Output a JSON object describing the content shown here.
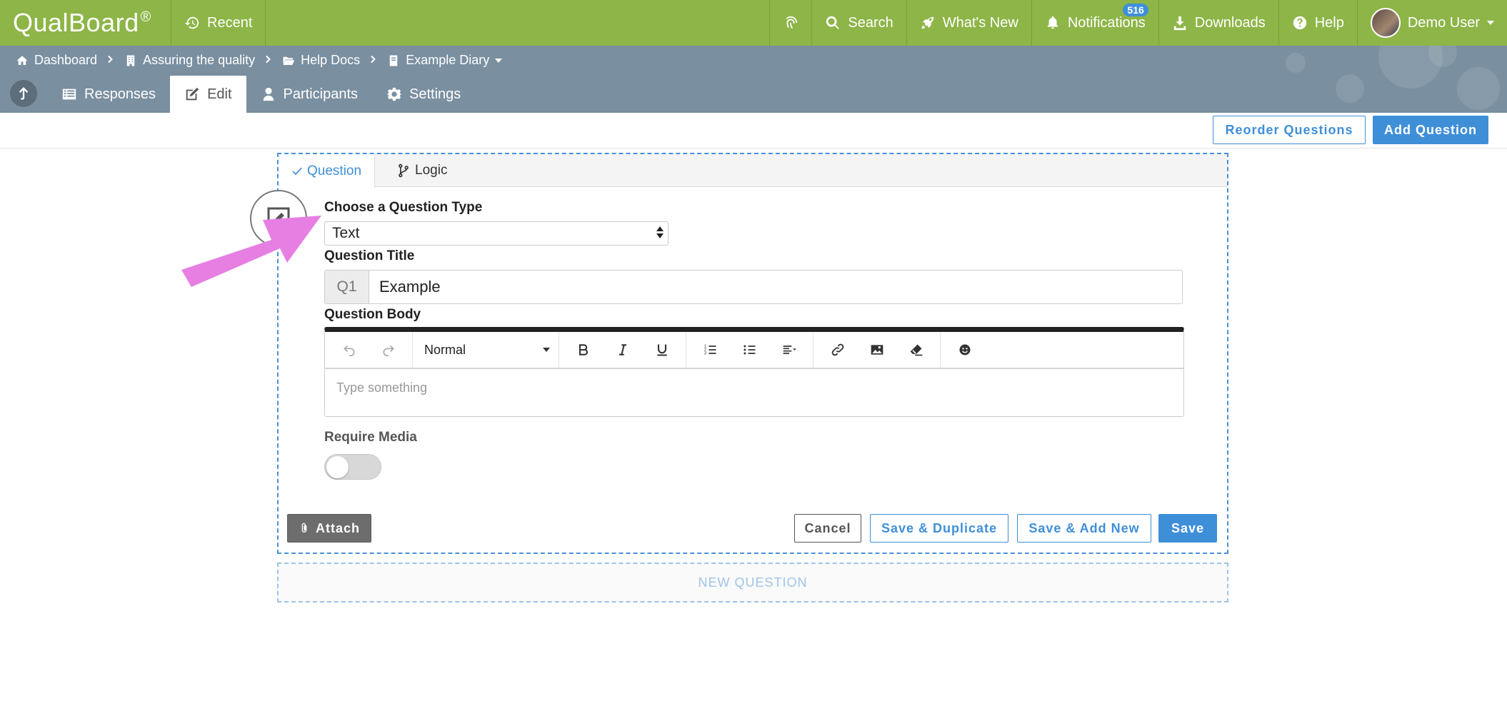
{
  "topbar": {
    "logo": "QualBoard",
    "logo_mark": "®",
    "recent": "Recent",
    "search": "Search",
    "whats_new": "What's New",
    "notifications": "Notifications",
    "notifications_count": "516",
    "downloads": "Downloads",
    "help": "Help",
    "user_name": "Demo User"
  },
  "breadcrumb": [
    {
      "label": "Dashboard",
      "icon": "home-icon"
    },
    {
      "label": "Assuring the quality",
      "icon": "building-icon"
    },
    {
      "label": "Help Docs",
      "icon": "folder-open-icon"
    },
    {
      "label": "Example Diary",
      "icon": "document-icon"
    }
  ],
  "nav_tabs": [
    {
      "label": "Responses",
      "icon": "list-icon",
      "active": false
    },
    {
      "label": "Edit",
      "icon": "edit-icon",
      "active": true
    },
    {
      "label": "Participants",
      "icon": "user-icon",
      "active": false
    },
    {
      "label": "Settings",
      "icon": "gear-icon",
      "active": false
    }
  ],
  "toolbar": {
    "reorder_label": "Reorder Questions",
    "add_label": "Add Question"
  },
  "editor": {
    "tabs": [
      {
        "label": "Question",
        "active": true
      },
      {
        "label": "Logic",
        "active": false
      }
    ],
    "question_type_label": "Choose a Question Type",
    "question_type_value": "Text",
    "title_label": "Question Title",
    "title_prefix": "Q1",
    "title_value": "Example",
    "body_label": "Question Body",
    "format_value": "Normal",
    "body_placeholder": "Type something",
    "require_media_label": "Require Media",
    "require_media_on": false
  },
  "actions": {
    "attach": "Attach",
    "cancel": "Cancel",
    "save_duplicate": "Save & Duplicate",
    "save_add_new": "Save & Add New",
    "save": "Save"
  },
  "new_question_label": "NEW QUESTION",
  "colors": {
    "topbar": "#8db547",
    "subheader": "#7a8fa0",
    "accent": "#3f8fd8",
    "annotation_arrow": "#e77fe3"
  }
}
